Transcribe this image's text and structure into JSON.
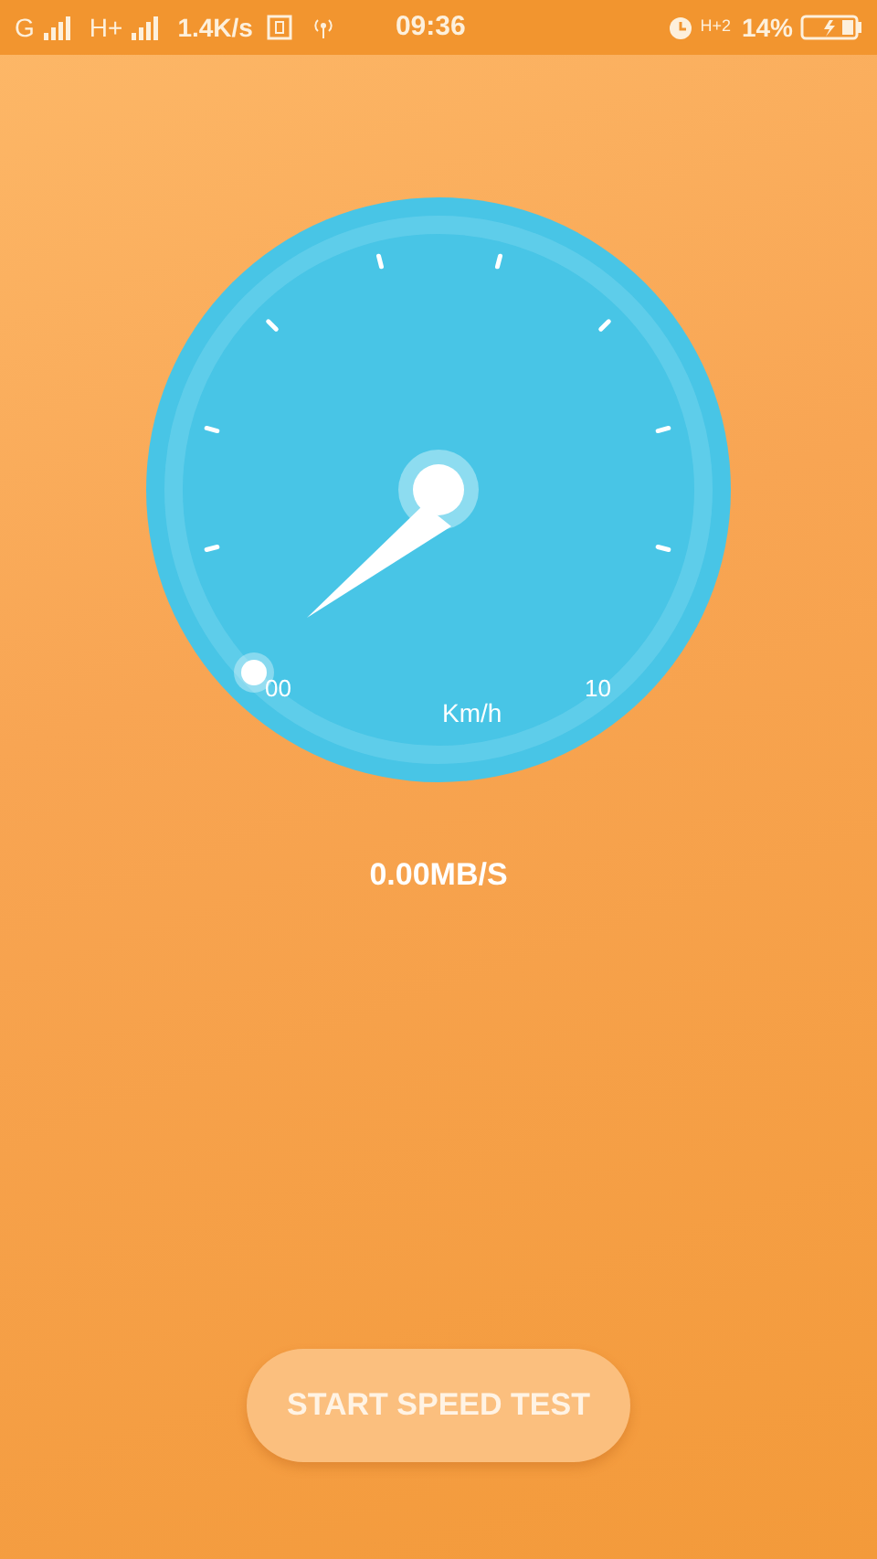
{
  "status_bar": {
    "network_1": "G",
    "network_2": "H+",
    "speed": "1.4K/s",
    "time": "09:36",
    "network_3": "H+2",
    "battery": "14%"
  },
  "gauge": {
    "min_label": "00",
    "max_label": "10",
    "unit": "Km/h"
  },
  "reading": "0.00MB/S",
  "start_button": {
    "label": "START SPEED TEST"
  }
}
